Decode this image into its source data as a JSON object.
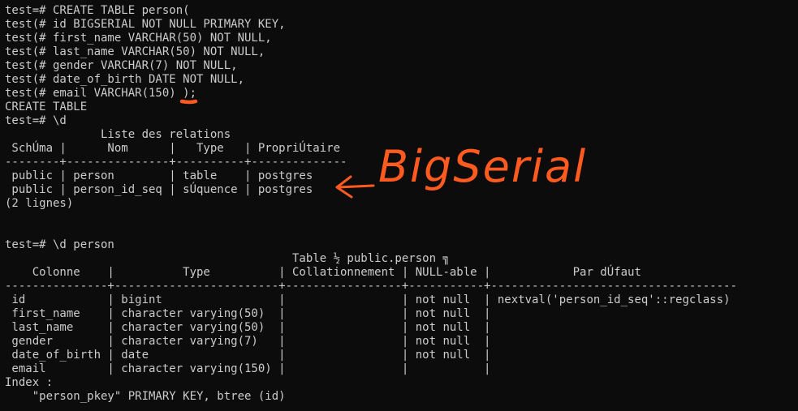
{
  "terminal": {
    "lines": [
      "test=# CREATE TABLE person(",
      "test(# id BIGSERIAL NOT NULL PRIMARY KEY,",
      "test(# first_name VARCHAR(50) NOT NULL,",
      "test(# last_name VARCHAR(50) NOT NULL,",
      "test(# gender VARCHAR(7) NOT NULL,",
      "test(# date_of_birth DATE NOT NULL,",
      "test(# email VARCHAR(150) );",
      "CREATE TABLE",
      "test=# \\d",
      "              Liste des relations",
      " SchÚma |      Nom      |   Type   | PropriÚtaire",
      "--------+---------------+----------+--------------",
      " public | person        | table    | postgres",
      " public | person_id_seq | sÚquence | postgres",
      "(2 lignes)",
      "",
      "",
      "test=# \\d person",
      "                                          Table ½ public.person ╗",
      "    Colonne    |          Type          | Collationnement | NULL-able |            Par dÚfaut",
      "---------------+------------------------+-----------------+-----------+------------------------------------",
      " id            | bigint                 |                 | not null  | nextval('person_id_seq'::regclass)",
      " first_name    | character varying(50)  |                 | not null  |",
      " last_name     | character varying(50)  |                 | not null  |",
      " gender        | character varying(7)   |                 | not null  |",
      " date_of_birth | date                   |                 | not null  |",
      " email         | character varying(150) |                 |           |",
      "Index :",
      "    \"person_pkey\" PRIMARY KEY, btree (id)"
    ]
  },
  "annotation": {
    "text": "BigSerial",
    "color": "#ff5a1f"
  },
  "colors": {
    "background": "#0c0c0c",
    "foreground": "#cccccc"
  }
}
